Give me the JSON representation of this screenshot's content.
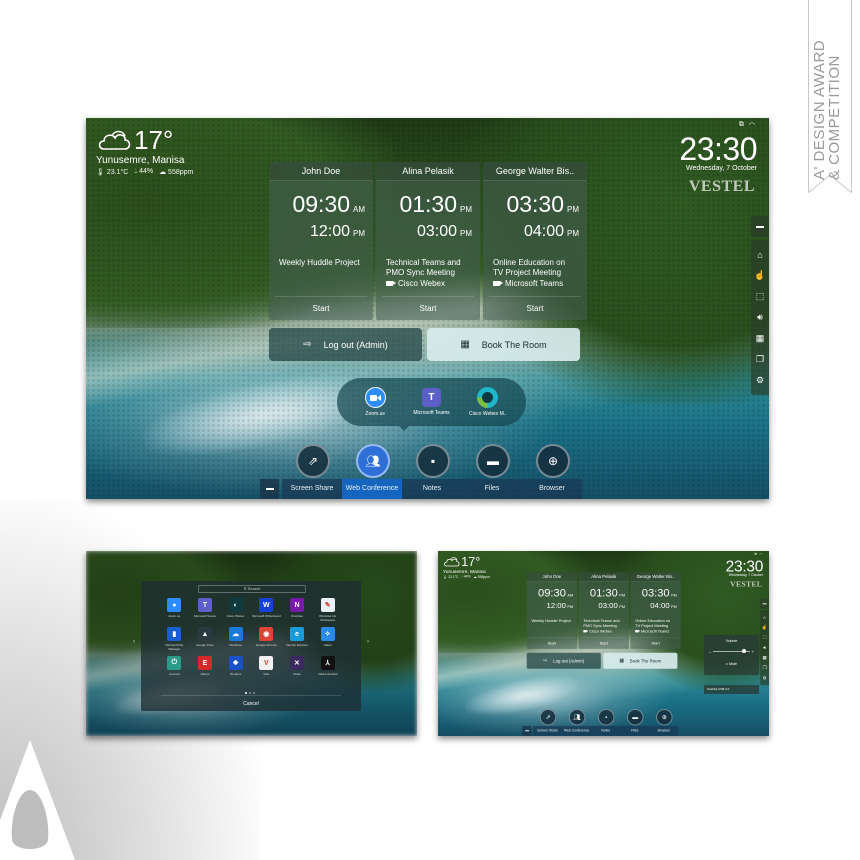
{
  "award": {
    "line1": "A' DESIGN AWARD",
    "line2": "& COMPETITION"
  },
  "main_screen": {
    "weather": {
      "temperature": "17°",
      "location": "Yunusemre, Manisa",
      "stats": [
        {
          "icon": "thermometer-icon",
          "value": "23.1°C"
        },
        {
          "icon": "humidity-icon",
          "value": "44%"
        },
        {
          "icon": "cloud-icon",
          "value": "558ppm"
        }
      ]
    },
    "status_icons": [
      "network-icon",
      "wifi-icon"
    ],
    "clock": {
      "time": "23:30",
      "date": "Wednesday, 7 October"
    },
    "brand": "VESTEL",
    "meetings": [
      {
        "organizer": "John Doe",
        "start": "09:30",
        "start_ampm": "AM",
        "end": "12:00",
        "end_ampm": "PM",
        "title": "Weekly Huddle Project",
        "platform": "",
        "action": "Start"
      },
      {
        "organizer": "Alina Pelasik",
        "start": "01:30",
        "start_ampm": "PM",
        "end": "03:00",
        "end_ampm": "PM",
        "title": "Technical Teams and PMO Sync Meeting",
        "platform": "Cisco Webex",
        "action": "Start"
      },
      {
        "organizer": "George Walter Bis..",
        "start": "03:30",
        "start_ampm": "PM",
        "end": "04:00",
        "end_ampm": "PM",
        "title": "Online Education on TV Project Meeting",
        "platform": "Microsoft Teams",
        "action": "Start"
      }
    ],
    "actions": {
      "logout": "Log out (Admin)",
      "book": "Book The Room"
    },
    "conference_apps": [
      {
        "name": "Zoom.us",
        "icon": "zoom-icon",
        "color": "#2d8cff"
      },
      {
        "name": "Microsoft Teams",
        "icon": "teams-icon",
        "color": "#5b5fc7"
      },
      {
        "name": "Cisco Webex M..",
        "icon": "webex-icon",
        "color": "#1fb6c9"
      }
    ],
    "dock": [
      {
        "label": "Screen Share",
        "icon": "screen-share-icon",
        "active": false
      },
      {
        "label": "Web Conference",
        "icon": "web-conference-icon",
        "active": true
      },
      {
        "label": "Notes",
        "icon": "notes-icon",
        "active": false
      },
      {
        "label": "Files",
        "icon": "folder-icon",
        "active": false
      },
      {
        "label": "Browser",
        "icon": "globe-icon",
        "active": false
      }
    ],
    "side_bar": [
      "home-icon",
      "touch-icon",
      "screenshot-icon",
      "volume-icon",
      "apps-grid-icon",
      "windows-icon",
      "settings-icon"
    ],
    "colors": {
      "accent": "#1565c0",
      "active_circle": "#2e6fd8"
    }
  },
  "apps_screen": {
    "search_placeholder": "Search",
    "apps": [
      {
        "name": "Zoom.us",
        "color": "#2d8cff",
        "glyph": "●"
      },
      {
        "name": "Microsoft Teams",
        "color": "#5b5fc7",
        "glyph": "T"
      },
      {
        "name": "Cisco Webex",
        "color": "#0f3b40",
        "glyph": "◐"
      },
      {
        "name": "Microsoft Whiteboard",
        "color": "#1740d8",
        "glyph": "W"
      },
      {
        "name": "OneNote",
        "color": "#7719aa",
        "glyph": "N"
      },
      {
        "name": "Windows Ink Workspace",
        "color": "#e8f0f8",
        "glyph": "✎"
      },
      {
        "name": "Microsoft File Manager",
        "color": "#1a5fd0",
        "glyph": "▮"
      },
      {
        "name": "Google Drive",
        "color": "#2a3a40",
        "glyph": "▲"
      },
      {
        "name": "OneDrive",
        "color": "#1a78d8",
        "glyph": "☁"
      },
      {
        "name": "Google Chrome",
        "color": "#db4437",
        "glyph": "◉"
      },
      {
        "name": "Internet Explorer",
        "color": "#1a9ad8",
        "glyph": "e"
      },
      {
        "name": "Safari",
        "color": "#2a8ae8",
        "glyph": "✧"
      },
      {
        "name": "Connect",
        "color": "#2a9a8a",
        "glyph": "⏻"
      },
      {
        "name": "Others",
        "color": "#d42a2a",
        "glyph": "E"
      },
      {
        "name": "Dropbox",
        "color": "#1a50c8",
        "glyph": "❖"
      },
      {
        "name": "Vibe",
        "color": "#f2f2f2",
        "glyph": "V"
      },
      {
        "name": "Mode",
        "color": "#3a2a60",
        "glyph": "✕"
      },
      {
        "name": "Adobe Acrobat",
        "color": "#111111",
        "glyph": "⅄"
      }
    ],
    "page_dots": 3,
    "current_page": 1,
    "cancel": "Cancel"
  },
  "volume_screen": {
    "volume_title": "Volume",
    "volume_level": 0.85,
    "mute_label": "Mute",
    "usb_toast": "Toshiba USB 3.0"
  }
}
